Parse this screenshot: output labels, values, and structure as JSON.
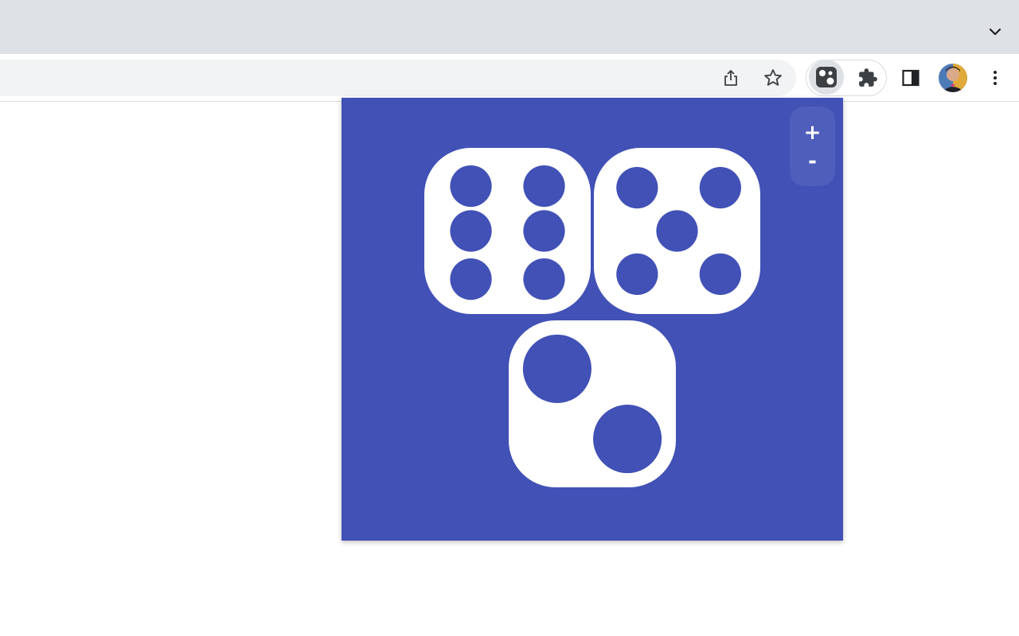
{
  "browser": {
    "icons": {
      "tab_search": "chevron-down-icon",
      "share": "share-icon",
      "bookmark": "star-icon",
      "extension_active": "dice-icon",
      "extensions": "puzzle-icon",
      "side_panel": "side-panel-icon",
      "profile": "avatar",
      "menu": "kebab-menu-icon"
    }
  },
  "popup": {
    "background_color": "#4151b6",
    "dice_color": "#ffffff",
    "dice": [
      {
        "name": "die-six",
        "value": 6
      },
      {
        "name": "die-five",
        "value": 5
      },
      {
        "name": "die-two",
        "value": 2
      }
    ],
    "zoom": {
      "plus_label": "+",
      "minus_label": "-"
    }
  }
}
